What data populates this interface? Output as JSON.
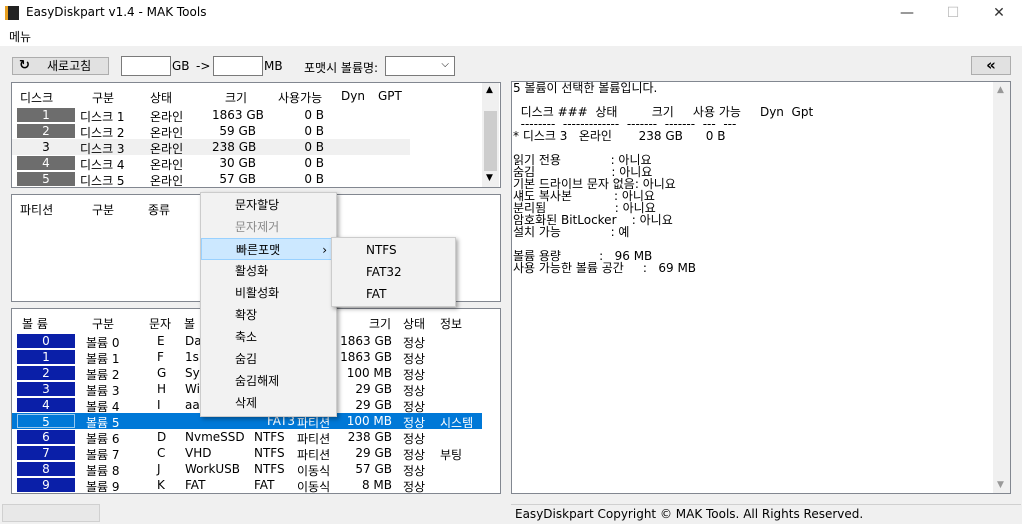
{
  "window": {
    "title": "EasyDiskpart v1.4 - MAK Tools",
    "minimize": "—",
    "maximize": "☐",
    "close": "✕"
  },
  "menu": {
    "label": "메뉴"
  },
  "toolbar": {
    "refresh_label": "새로고침",
    "refresh_icon": "↻",
    "gb_value": "",
    "gb_label": "GB",
    "arrow_label": "->",
    "mb_value": "",
    "mb_label": "MB",
    "format_label": "포맷시 볼륨명:",
    "format_value": "",
    "collapse_icon": "«"
  },
  "disks": {
    "headers": [
      "디스크",
      "구분",
      "상태",
      "크기",
      "사용가능",
      "Dyn",
      "GPT"
    ],
    "rows": [
      {
        "num": "1",
        "name": "디스크 1",
        "status": "온라인",
        "size": "1863 GB",
        "free": "0 B"
      },
      {
        "num": "2",
        "name": "디스크 2",
        "status": "온라인",
        "size": "59 GB",
        "free": "0 B"
      },
      {
        "num": "3",
        "name": "디스크 3",
        "status": "온라인",
        "size": "238 GB",
        "free": "0 B"
      },
      {
        "num": "4",
        "name": "디스크 4",
        "status": "온라인",
        "size": "30 GB",
        "free": "0 B"
      },
      {
        "num": "5",
        "name": "디스크 5",
        "status": "온라인",
        "size": "57 GB",
        "free": "0 B"
      }
    ]
  },
  "partitions": {
    "headers": [
      "파티션",
      "구분",
      "종류"
    ]
  },
  "volumes": {
    "headers": [
      "볼 륨",
      "구분",
      "문자",
      "볼",
      "크기",
      "상태",
      "정보"
    ],
    "rows": [
      {
        "num": "0",
        "name": "볼륨 0",
        "letter": "E",
        "label": "Da",
        "fs": "",
        "type": "",
        "size": "1863 GB",
        "status": "정상",
        "info": ""
      },
      {
        "num": "1",
        "name": "볼륨 1",
        "letter": "F",
        "label": "1s",
        "fs": "",
        "type": "",
        "size": "1863 GB",
        "status": "정상",
        "info": ""
      },
      {
        "num": "2",
        "name": "볼륨 2",
        "letter": "G",
        "label": "Sy",
        "fs": "",
        "type": "",
        "size": "100 MB",
        "status": "정상",
        "info": ""
      },
      {
        "num": "3",
        "name": "볼륨 3",
        "letter": "H",
        "label": "Wi",
        "fs": "",
        "type": "",
        "size": "29 GB",
        "status": "정상",
        "info": ""
      },
      {
        "num": "4",
        "name": "볼륨 4",
        "letter": "I",
        "label": "aa",
        "fs": "",
        "type": "",
        "size": "29 GB",
        "status": "정상",
        "info": ""
      },
      {
        "num": "5",
        "name": "볼륨 5",
        "letter": "",
        "label": "",
        "fs": "FAT3",
        "type": "파티션",
        "size": "100 MB",
        "status": "정상",
        "info": "시스템"
      },
      {
        "num": "6",
        "name": "볼륨 6",
        "letter": "D",
        "label": "NvmeSSD",
        "fs": "NTFS",
        "type": "파티션",
        "size": "238 GB",
        "status": "정상",
        "info": ""
      },
      {
        "num": "7",
        "name": "볼륨 7",
        "letter": "C",
        "label": "VHD",
        "fs": "NTFS",
        "type": "파티션",
        "size": "29 GB",
        "status": "정상",
        "info": "부팅"
      },
      {
        "num": "8",
        "name": "볼륨 8",
        "letter": "J",
        "label": "WorkUSB",
        "fs": "NTFS",
        "type": "이동식",
        "size": "57 GB",
        "status": "정상",
        "info": ""
      },
      {
        "num": "9",
        "name": "볼륨 9",
        "letter": "K",
        "label": "FAT",
        "fs": "FAT",
        "type": "이동식",
        "size": "8 MB",
        "status": "정상",
        "info": ""
      }
    ]
  },
  "info_panel": {
    "text": "5 볼륨이 선택한 볼륨입니다.\n\n  디스크 ###  상태         크기     사용 가능     Dyn  Gpt\n  --------  -------------  -------  -------  ---  ---\n* 디스크 3   온라인       238 GB      0 B\n\n읽기 전용             : 아니요\n숨김                    : 아니요\n기본 드라이브 문자 없음: 아니요\n섀도 복사본           : 아니요\n분리됨                  : 아니요\n암호화된 BitLocker    : 아니요\n설치 가능             : 예\n\n볼륨 용량          :   96 MB\n사용 가능한 볼륨 공간     :   69 MB"
  },
  "context_menu": {
    "items": [
      "문자할당",
      "문자제거",
      "빠른포맷",
      "활성화",
      "비활성화",
      "확장",
      "축소",
      "숨김",
      "숨김해제",
      "삭제"
    ],
    "submenu_arrow": "›"
  },
  "submenu": {
    "items": [
      "NTFS",
      "FAT32",
      "FAT"
    ]
  },
  "status": {
    "copyright": "EasyDiskpart Copyright © MAK Tools. All Rights Reserved."
  }
}
